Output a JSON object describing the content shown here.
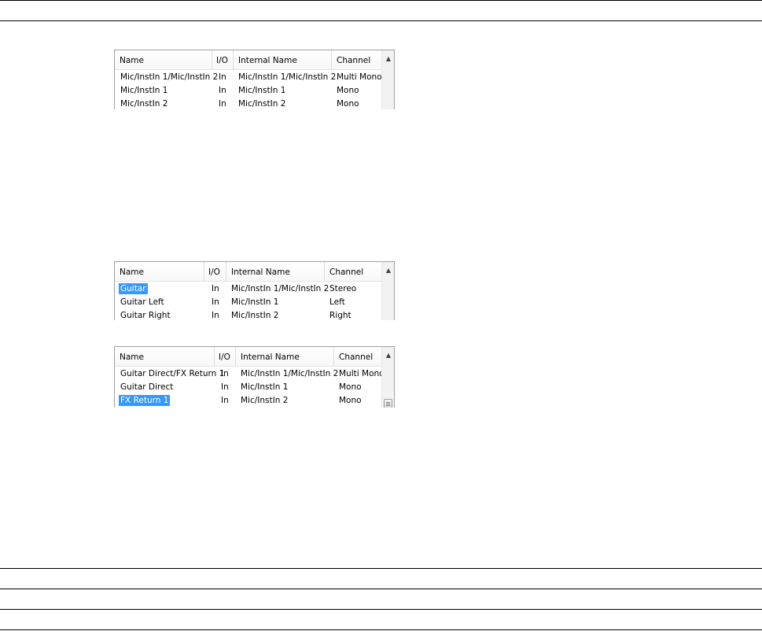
{
  "table1": {
    "headers": [
      "Name",
      "I/O",
      "Internal Name",
      "Channel"
    ],
    "rows": [
      [
        "Mic/InstIn 1/Mic/InstIn 2",
        "In",
        "Mic/InstIn 1/Mic/InstIn 2",
        "Multi Mono"
      ],
      [
        "Mic/InstIn 1",
        "In",
        "Mic/InstIn 1",
        "Mono"
      ],
      [
        "Mic/InstIn 2",
        "In",
        "Mic/InstIn 2",
        "Mono"
      ]
    ],
    "scroll_up_icon": "scroll-up-arrow-icon"
  },
  "table2": {
    "headers": [
      "Name",
      "I/O",
      "Internal Name",
      "Channel"
    ],
    "rows": [
      [
        "Guitar",
        "In",
        "Mic/InstIn 1/Mic/InstIn 2",
        "Stereo"
      ],
      [
        "Guitar Left",
        "In",
        "Mic/InstIn 1",
        "Left"
      ],
      [
        "Guitar Right",
        "In",
        "Mic/InstIn 2",
        "Right"
      ]
    ],
    "selected_row": 0,
    "scroll_up_icon": "scroll-up-arrow-icon"
  },
  "table3": {
    "headers": [
      "Name",
      "I/O",
      "Internal Name",
      "Channel"
    ],
    "rows": [
      [
        "Guitar Direct/FX Return 1",
        "In",
        "Mic/InstIn 1/Mic/InstIn 2",
        "Multi Mono"
      ],
      [
        "Guitar Direct",
        "In",
        "Mic/InstIn 1",
        "Mono"
      ],
      [
        "FX Return 1",
        "In",
        "Mic/InstIn 2",
        "Mono"
      ]
    ],
    "selected_row": 2,
    "scroll_up_icon": "scroll-up-arrow-icon"
  },
  "colors": {
    "selection": "#3399ff",
    "rule": "#000000",
    "table_border": "#a0a0a0"
  }
}
